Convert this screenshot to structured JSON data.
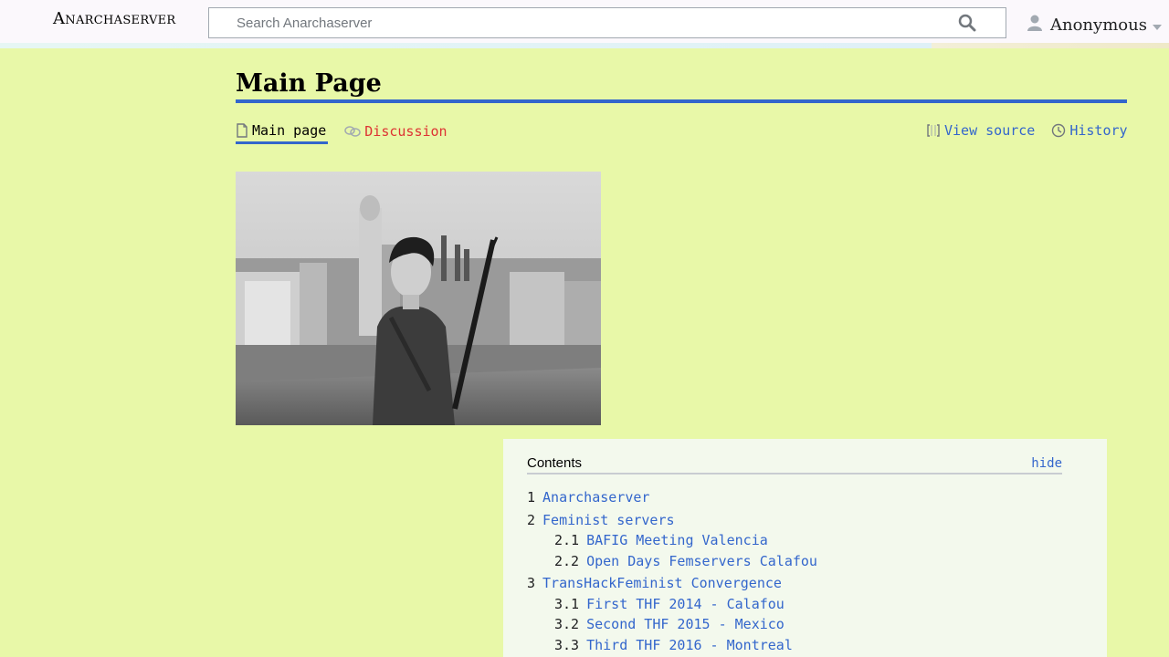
{
  "site": {
    "name": "Anarchaserver"
  },
  "search": {
    "placeholder": "Search Anarchaserver"
  },
  "user": {
    "name": "Anonymous"
  },
  "page": {
    "title": "Main Page"
  },
  "tabs": {
    "main_page": "Main page",
    "discussion": "Discussion",
    "view_source": "View source",
    "history": "History"
  },
  "toc": {
    "title": "Contents",
    "hide_label": "hide",
    "items": [
      {
        "num": "1",
        "label": "Anarchaserver",
        "children": []
      },
      {
        "num": "2",
        "label": "Feminist servers",
        "children": [
          {
            "num": "2.1",
            "label": "BAFIG Meeting Valencia"
          },
          {
            "num": "2.2",
            "label": "Open Days Femservers Calafou"
          }
        ]
      },
      {
        "num": "3",
        "label": "TransHackFeminist Convergence",
        "children": [
          {
            "num": "3.1",
            "label": "First THF 2014 - Calafou"
          },
          {
            "num": "3.2",
            "label": "Second THF 2015 - Mexico"
          },
          {
            "num": "3.3",
            "label": "Third THF 2016 - Montreal"
          }
        ]
      }
    ]
  },
  "colors": {
    "link": "#3366cc",
    "new_link": "#dd3333",
    "background": "#e8f8a8"
  }
}
